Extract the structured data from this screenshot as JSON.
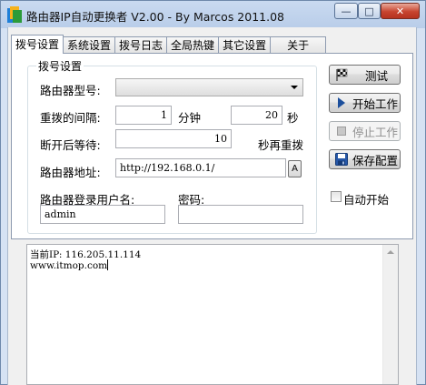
{
  "window": {
    "title": "路由器IP自动更换者 V2.00 - By Marcos 2011.08"
  },
  "tabs": [
    {
      "label": "拨号设置",
      "active": true
    },
    {
      "label": "系统设置",
      "active": false
    },
    {
      "label": "拨号日志",
      "active": false
    },
    {
      "label": "全局热键",
      "active": false
    },
    {
      "label": "其它设置",
      "active": false
    },
    {
      "label": "关于",
      "active": false
    }
  ],
  "dial_group": {
    "title": "拨号设置",
    "router_model_label": "路由器型号:",
    "router_model_value": "",
    "redial_interval_label": "重拨的间隔:",
    "redial_interval_value": "1",
    "redial_interval_unit": "分钟",
    "redial_seconds_value": "20",
    "redial_seconds_unit": "秒",
    "disconnect_wait_label": "断开后等待:",
    "disconnect_wait_value": "10",
    "disconnect_wait_suffix": "秒再重拨",
    "router_address_label": "路由器地址:",
    "router_address_value": "http://192.168.0.1/",
    "router_address_btn": "A",
    "username_label": "路由器登录用户名:",
    "username_value": "admin",
    "password_label": "密码:",
    "password_value": ""
  },
  "actions": {
    "test": "测试",
    "start": "开始工作",
    "stop": "停止工作",
    "save": "保存配置",
    "auto_start": "自动开始"
  },
  "log": {
    "line1": "当前IP: 116.205.11.114",
    "line2": "www.itmop.com"
  },
  "colors": {
    "title_bar": "#c9daf0",
    "close_button": "#c7442f",
    "window_bg": "#f0f0f0"
  }
}
